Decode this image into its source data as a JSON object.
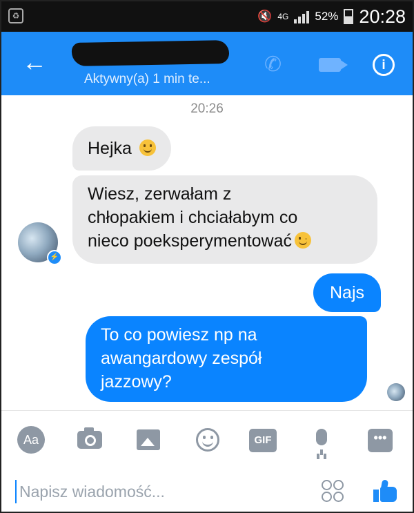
{
  "status_bar": {
    "network_type": "4G",
    "battery": "52%",
    "time": "20:28"
  },
  "header": {
    "contact_name": "",
    "active_status": "Aktywny(a) 1 min te..."
  },
  "conversation": {
    "timestamp": "20:26",
    "messages": [
      {
        "from": "them",
        "text": "Hejka",
        "emoji": "smile-emoji"
      },
      {
        "from": "them",
        "line1": "Wiesz, zerwałam z",
        "line2": "chłopakiem i chciałabym co",
        "line3": "nieco poeksperymentować",
        "emoji": "wink-emoji"
      },
      {
        "from": "me",
        "text": "Najs"
      },
      {
        "from": "me",
        "line1": "To co powiesz np na",
        "line2": "awangardowy zespół",
        "line3": "jazzowy?"
      }
    ]
  },
  "composer": {
    "aa_label": "Aa",
    "gif_label": "GIF",
    "more_label": "•••",
    "placeholder": "Napisz wiadomość..."
  },
  "colors": {
    "header": "#1e8cf8",
    "outgoing_bubble": "#0a84ff",
    "incoming_bubble": "#e9e9ea"
  }
}
